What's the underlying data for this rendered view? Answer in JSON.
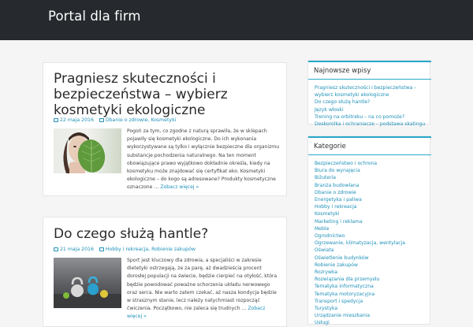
{
  "site": {
    "title": "Portal dla firm"
  },
  "posts": [
    {
      "title": "Pragniesz skuteczności i bezpieczeństwa – wybierz kosmetyki ekologiczne",
      "date": "22 maja 2016",
      "categories": "Dbanie o zdrowie, Kosmetyki",
      "excerpt": "Pogoń za tym, co zgodne z naturą sprawiła, że w sklepach pojawiły się kosmetyki ekologiczne. Do ich wykonania wykorzystywane są tylko i wyłącznie bezpieczne dla organizmu substancje pochodzenia naturalnego. Na ten moment obowiązujące prawo wyjątkowo dokładnie określa, kiedy na kosmetyku może znajdować się certyfikat eko. Kosmetyki ekologiczne – do kogo są adresowane? Produkty kosmetyczne oznaczone …",
      "more": "Zobacz więcej »"
    },
    {
      "title": "Do czego służą hantle?",
      "date": "21 maja 2016",
      "categories": "Hobby i rekreacja, Robienie zakupów",
      "excerpt": "Sport jest kluczowy dla zdrowia, a specjaliści w zakresie dietetyki ostrzegają, że za parę, aż dwadzieścia procent dorosłej populacji na świecie, będzie cierpieć na otyłość, która będzie powodować poważne schorzenia układu nerwowego oraz serca. Nie warto zatem czekać, aż nasza kondycja będzie w strasznym stanie, lecz należy natychmiast rozpocząć ćwiczenia. Początkowo, nie zaleca się trudnych …",
      "more": "Zobacz więcej »"
    }
  ],
  "sidebar": {
    "recent": {
      "title": "Najnowsze wpisy",
      "items": [
        "Pragniesz skuteczności i bezpieczeństwa – wybierz kosmetyki ekologiczne",
        "Do czego służą hantle?",
        "Język włoski",
        "Trening na orbitreku – na co pomoże?",
        "Deskorolka i ochraniacze – podstawa skatingu"
      ]
    },
    "categories": {
      "title": "Kategorie",
      "items": [
        "Bezpieczeństwo i ochrona",
        "Biura do wynajęcia",
        "Biżuteria",
        "Branża budowlana",
        "Dbanie o zdrowie",
        "Energetyka i paliwa",
        "Hobby i rekreacja",
        "Kosmetyki",
        "Marketing i reklama",
        "Meble",
        "Ogrodnictwo",
        "Ogrzewanie, klimatyzacja, wentylacja",
        "Oświata",
        "Oświetlenie budynków",
        "Robienie zakupów",
        "Rozrywka",
        "Rozwiązania dla przemysłu",
        "Tematyka informatyczna",
        "Tematyka motoryzacyjna",
        "Transport i spedycja",
        "Turystyka",
        "Urządzanie mieszkania",
        "Usługi"
      ]
    }
  }
}
